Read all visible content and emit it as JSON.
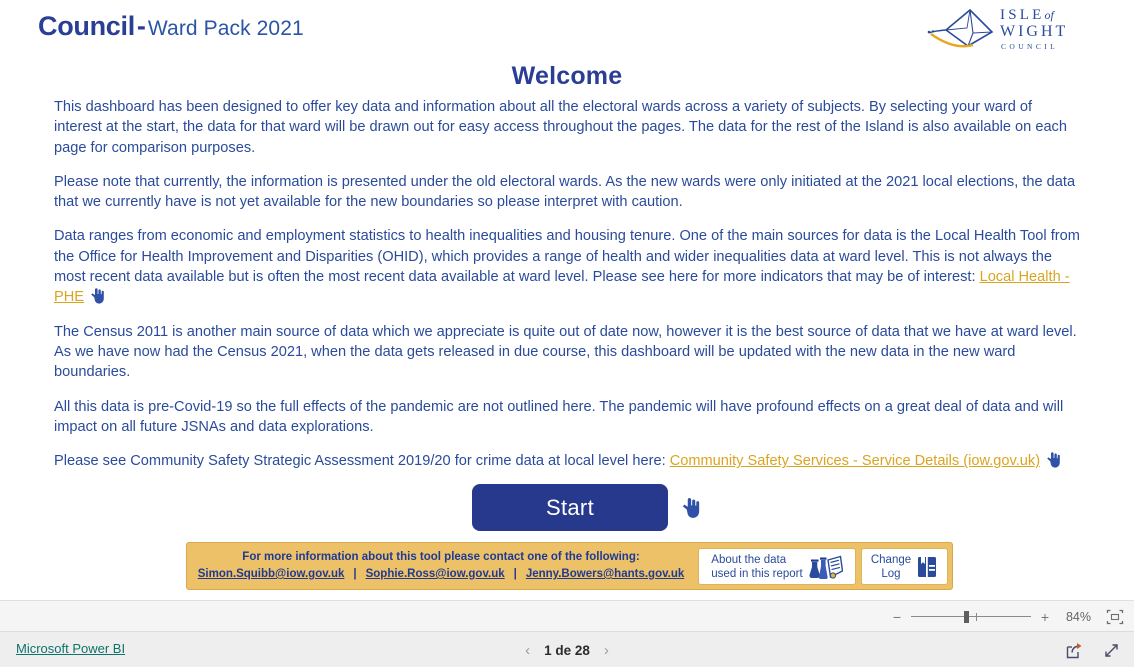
{
  "header": {
    "title_main": "Council",
    "title_dash": "-",
    "title_sub": "Ward Pack 2021",
    "logo": {
      "line1_isle": "ISLE",
      "line1_of": "of",
      "line2": "WIGHT",
      "line3": "COUNCIL"
    }
  },
  "main": {
    "heading": "Welcome",
    "paragraphs": {
      "p1": "This dashboard has been designed to offer key data and information about all the electoral wards across a variety of subjects. By selecting your ward of interest at the start, the data for that ward will be drawn out for easy access throughout the pages. The data for the rest of the Island is also available on each page for comparison purposes.",
      "p2": "Please note that currently, the information is presented under the old electoral wards. As the new wards were only initiated at the 2021 local elections, the data that we currently have is not yet available for the new boundaries so please interpret with caution.",
      "p3_before_link": "Data ranges from economic and employment statistics to health inequalities and housing tenure. One of the main sources for data is the Local Health Tool from the Office for Health Improvement and Disparities (OHID), which provides a range of health and wider inequalities data at ward level. This is not always the most recent data available but is often the most recent data available at ward level. Please see here for more indicators that may be of interest: ",
      "p3_link": "Local Health - PHE",
      "p4": "The Census 2011 is another main source of data which we appreciate is quite out of date now, however it is the best source of data that we have at ward level. As we have now had the Census 2021, when the data gets released in due course, this dashboard will be updated with the new data in the new ward boundaries.",
      "p5": "All this data is pre-Covid-19 so the full effects of the pandemic are not outlined here. The pandemic will have profound effects on a great deal of data and will impact on all future JSNAs and data explorations.",
      "p6_before_link": "Please see Community Safety Strategic Assessment 2019/20 for crime data at local level here: ",
      "p6_link": "Community Safety Services - Service Details (iow.gov.uk)"
    },
    "start_label": "Start"
  },
  "contact": {
    "intro": "For more information about this tool please contact one of the following:",
    "emails": [
      "Simon.Squibb@iow.gov.uk",
      "Sophie.Ross@iow.gov.uk",
      "Jenny.Bowers@hants.gov.uk"
    ],
    "separator": "|",
    "about_line1": "About the data",
    "about_line2": "used in this report",
    "changelog_line1": "Change",
    "changelog_line2": "Log"
  },
  "zoom_bar": {
    "minus": "−",
    "plus": "+",
    "percent": "84%"
  },
  "status_bar": {
    "powerbi_label": "Microsoft Power BI",
    "prev_arrow": "‹",
    "next_arrow": "›",
    "page_label": "1 de 28"
  },
  "icons": {
    "hand_pointer": "hand-pointer-icon",
    "about_data": "flask-document-icon",
    "change_log": "book-icon",
    "fit_to_page": "fit-to-page-icon",
    "share": "share-icon",
    "fullscreen": "fullscreen-icon"
  },
  "colors": {
    "brand_navy": "#2a3e95",
    "body_blue": "#2a4b9b",
    "link_gold": "#d9a520",
    "contact_bg": "#edc168",
    "start_bg": "#27398c",
    "powerbi_teal": "#10726b"
  }
}
